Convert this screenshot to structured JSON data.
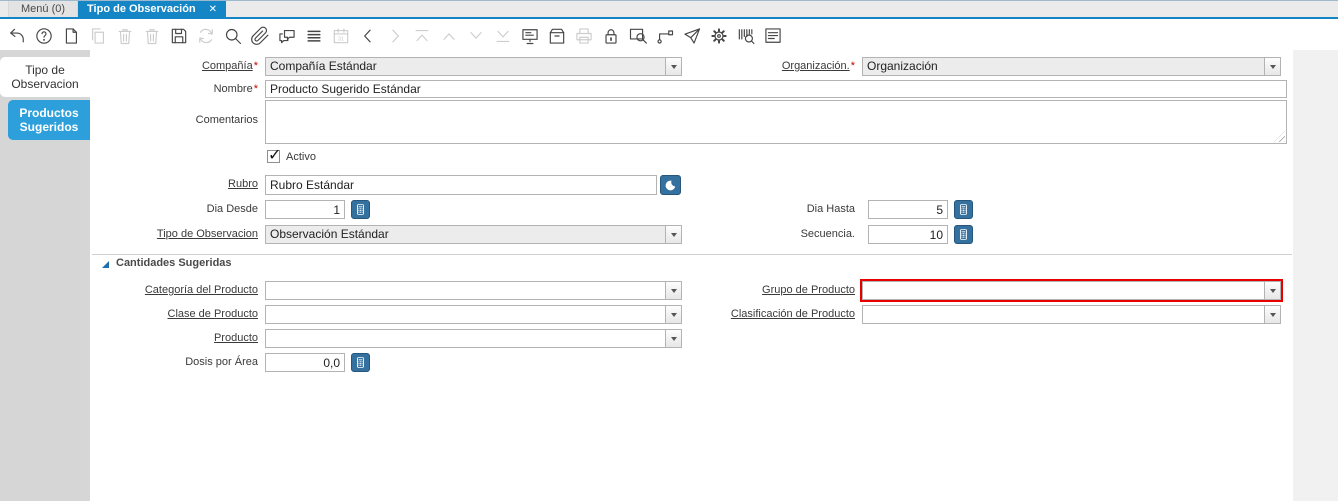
{
  "colors": {
    "accent_blue": "#1486c5",
    "sidebar_tab_blue": "#2da0dc",
    "action_button_blue": "#35719f",
    "error_border_red": "#e60000",
    "required_red": "#cc0000"
  },
  "tabbar": {
    "menu_tab": "Menú (0)",
    "active_tab": "Tipo de Observación",
    "close_glyph": "✕"
  },
  "toolbar": {
    "icons": [
      {
        "name": "undo",
        "enabled": true
      },
      {
        "name": "help",
        "enabled": true
      },
      {
        "name": "new-record",
        "enabled": true
      },
      {
        "name": "copy-record",
        "enabled": false
      },
      {
        "name": "delete-record",
        "enabled": false
      },
      {
        "name": "delete-selection",
        "enabled": false
      },
      {
        "name": "save",
        "enabled": true
      },
      {
        "name": "refresh",
        "enabled": false
      },
      {
        "name": "find",
        "enabled": true
      },
      {
        "name": "attachment",
        "enabled": true
      },
      {
        "name": "chat",
        "enabled": true
      },
      {
        "name": "grid-toggle",
        "enabled": true
      },
      {
        "name": "calendar",
        "enabled": false
      },
      {
        "name": "parent-record",
        "enabled": true
      },
      {
        "name": "detail-record",
        "enabled": false
      },
      {
        "name": "first-record",
        "enabled": false
      },
      {
        "name": "previous-record",
        "enabled": false
      },
      {
        "name": "next-record",
        "enabled": false
      },
      {
        "name": "last-record",
        "enabled": false
      },
      {
        "name": "report",
        "enabled": true
      },
      {
        "name": "archive",
        "enabled": true
      },
      {
        "name": "print",
        "enabled": false
      },
      {
        "name": "lock",
        "enabled": true
      },
      {
        "name": "zoom-across",
        "enabled": true
      },
      {
        "name": "workflow",
        "enabled": true
      },
      {
        "name": "send-request",
        "enabled": true
      },
      {
        "name": "preference",
        "enabled": true
      },
      {
        "name": "product-info",
        "enabled": true
      },
      {
        "name": "report-window",
        "enabled": true
      }
    ]
  },
  "sidebar": {
    "tabs": [
      {
        "line1": "Tipo de",
        "line2": "Observacion"
      },
      {
        "line1": "Productos",
        "line2": "Sugeridos"
      }
    ]
  },
  "form": {
    "company": {
      "label": "Compañía",
      "req": "*",
      "value": "Compañía Estándar"
    },
    "organization": {
      "label": "Organización.",
      "req": "*",
      "value": "Organización"
    },
    "name": {
      "label": "Nombre",
      "req": "*",
      "value": "Producto Sugerido Estándar"
    },
    "comments": {
      "label": "Comentarios",
      "value": ""
    },
    "active": {
      "label": "Activo",
      "checked": true,
      "glyph": "✓"
    },
    "rubro": {
      "label": "Rubro",
      "value": "Rubro Estándar"
    },
    "day_from": {
      "label": "Dia Desde",
      "value": "1"
    },
    "day_to": {
      "label": "Dia Hasta",
      "value": "5"
    },
    "observation_type": {
      "label": "Tipo de Observacion",
      "value": "Observación Estándar"
    },
    "sequence": {
      "label": "Secuencia.",
      "value": "10"
    },
    "section": {
      "title": "Cantidades Sugeridas"
    },
    "product_category": {
      "label": "Categoría del Producto",
      "value": ""
    },
    "product_group": {
      "label": "Grupo de Producto",
      "value": ""
    },
    "product_class": {
      "label": "Clase de Producto",
      "value": ""
    },
    "product_classification": {
      "label": "Clasificación de Producto",
      "value": ""
    },
    "product": {
      "label": "Producto",
      "value": ""
    },
    "dose_per_area": {
      "label": "Dosis por Área",
      "value": "0,0"
    }
  }
}
